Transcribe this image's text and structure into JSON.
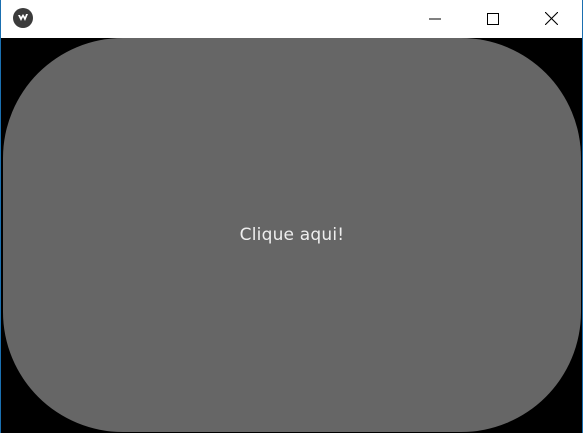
{
  "window": {
    "title": "",
    "app_icon": "kivy-app-icon",
    "controls": {
      "minimize_icon": "minimize-icon",
      "maximize_icon": "maximize-icon",
      "close_icon": "close-icon"
    }
  },
  "main": {
    "button_label": "Clique aqui!"
  },
  "colors": {
    "titlebar": "#ffffff",
    "window_background": "#000000",
    "button_background": "#666666",
    "button_text": "#eeeeee"
  }
}
